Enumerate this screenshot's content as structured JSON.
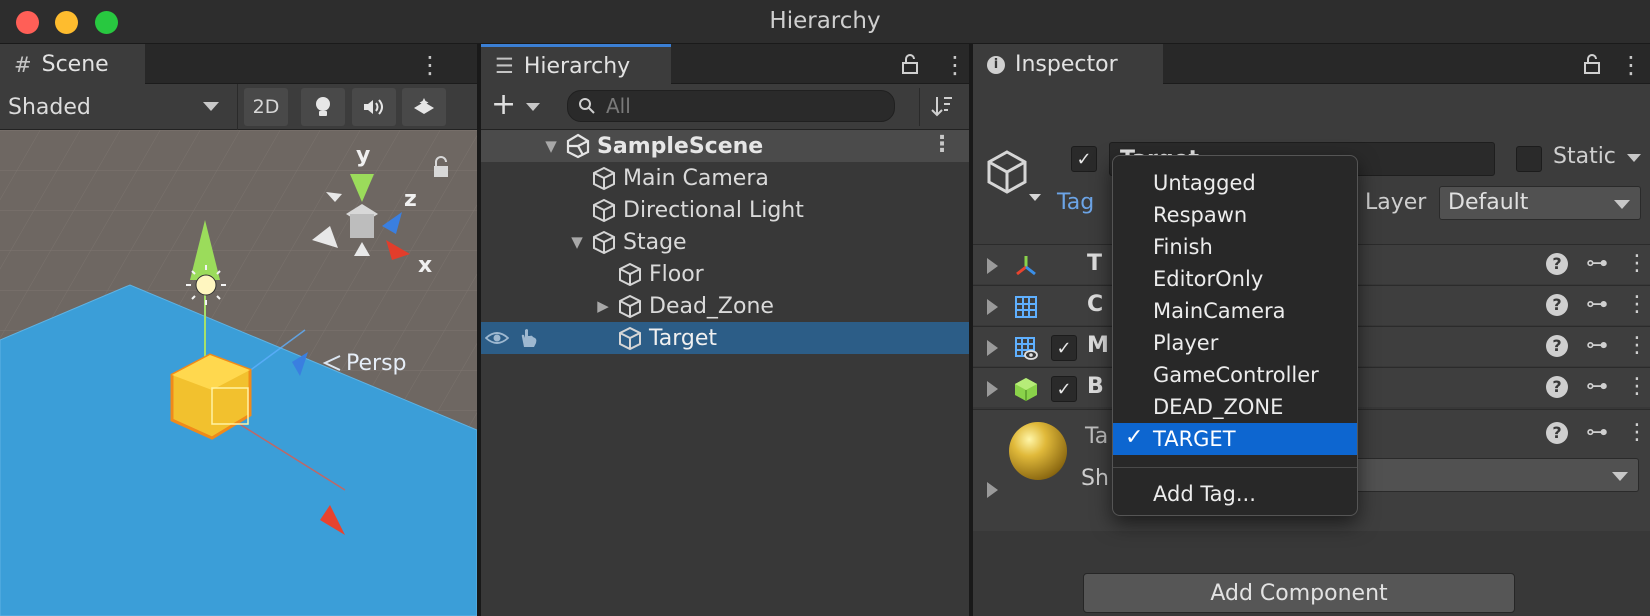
{
  "window": {
    "title": "Hierarchy"
  },
  "scene": {
    "tab_label": "Scene",
    "shading_mode": "Shaded",
    "btn_2d": "2D",
    "gizmo": {
      "y": "y",
      "x": "x",
      "z": "z",
      "persp": "Persp"
    }
  },
  "hierarchy": {
    "tab_label": "Hierarchy",
    "search_placeholder": "All",
    "items": [
      {
        "label": "SampleScene",
        "depth": 0,
        "expanded": true,
        "type": "scene"
      },
      {
        "label": "Main Camera",
        "depth": 1,
        "type": "gameobject"
      },
      {
        "label": "Directional Light",
        "depth": 1,
        "type": "gameobject"
      },
      {
        "label": "Stage",
        "depth": 1,
        "expanded": true,
        "type": "gameobject"
      },
      {
        "label": "Floor",
        "depth": 2,
        "type": "gameobject"
      },
      {
        "label": "Dead_Zone",
        "depth": 2,
        "expanded": false,
        "type": "gameobject"
      },
      {
        "label": "Target",
        "depth": 2,
        "type": "gameobject",
        "selected": true
      }
    ]
  },
  "inspector": {
    "tab_label": "Inspector",
    "object_name": "Target",
    "static_label": "Static",
    "tag_label": "Tag",
    "layer_label": "Layer",
    "layer_value": "Default",
    "components": [
      {
        "name": "T",
        "icon": "transform-icon"
      },
      {
        "name": "C",
        "icon": "grid-icon"
      },
      {
        "name": "M",
        "icon": "mesh-renderer-icon"
      },
      {
        "name": "B",
        "icon": "box-collider-icon"
      }
    ],
    "material_name": "Ta",
    "material_shader_label": "Sh",
    "add_component_label": "Add Component"
  },
  "tag_menu": {
    "items": [
      "Untagged",
      "Respawn",
      "Finish",
      "EditorOnly",
      "MainCamera",
      "Player",
      "GameController",
      "DEAD_ZONE",
      "TARGET"
    ],
    "selected": "TARGET",
    "check_glyph": "✓",
    "add_tag_label": "Add Tag..."
  },
  "colors": {
    "accent_blue": "#0d66d0",
    "selection": "#2c5d87",
    "tag_link": "#6ca4e6"
  }
}
